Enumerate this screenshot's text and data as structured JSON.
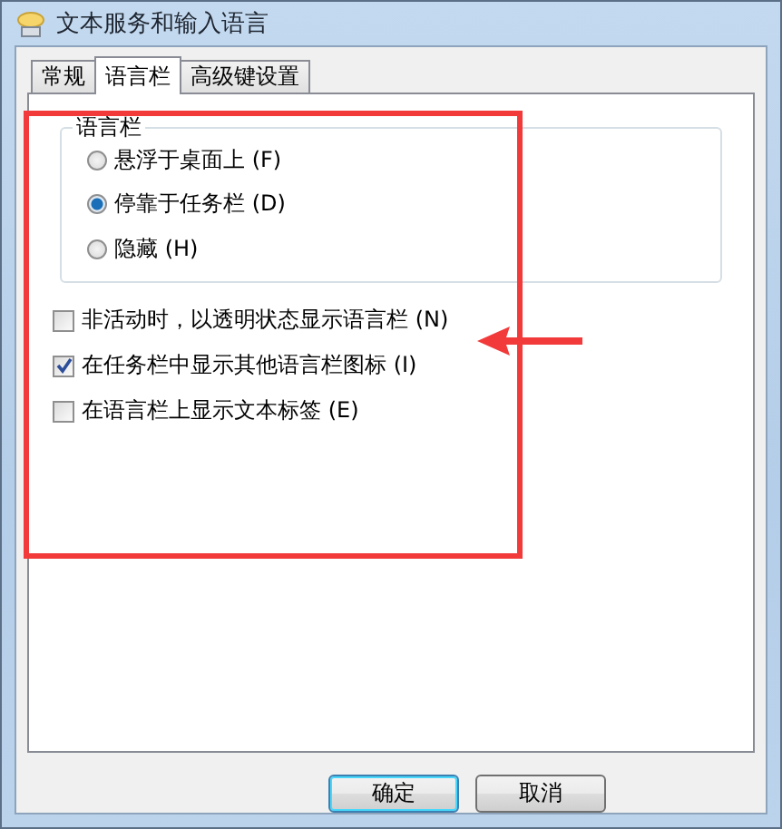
{
  "window": {
    "title": "文本服务和输入语言"
  },
  "tabs": [
    {
      "label": "常规",
      "selected": false
    },
    {
      "label": "语言栏",
      "selected": true
    },
    {
      "label": "高级键设置",
      "selected": false
    }
  ],
  "group": {
    "title": "语言栏",
    "options": [
      {
        "label": "悬浮于桌面上",
        "key": "(F)",
        "selected": false
      },
      {
        "label": "停靠于任务栏",
        "key": "(D)",
        "selected": true
      },
      {
        "label": "隐藏",
        "key": "(H)",
        "selected": false
      }
    ]
  },
  "checkboxes": [
    {
      "label": "非活动时，以透明状态显示语言栏",
      "key": "(N)",
      "checked": false
    },
    {
      "label": "在任务栏中显示其他语言栏图标",
      "key": "(I)",
      "checked": true
    },
    {
      "label": "在语言栏上显示文本标签",
      "key": "(E)",
      "checked": false
    }
  ],
  "buttons": [
    {
      "label": "确定",
      "kind": "default"
    },
    {
      "label": "取消",
      "kind": "normal"
    }
  ]
}
